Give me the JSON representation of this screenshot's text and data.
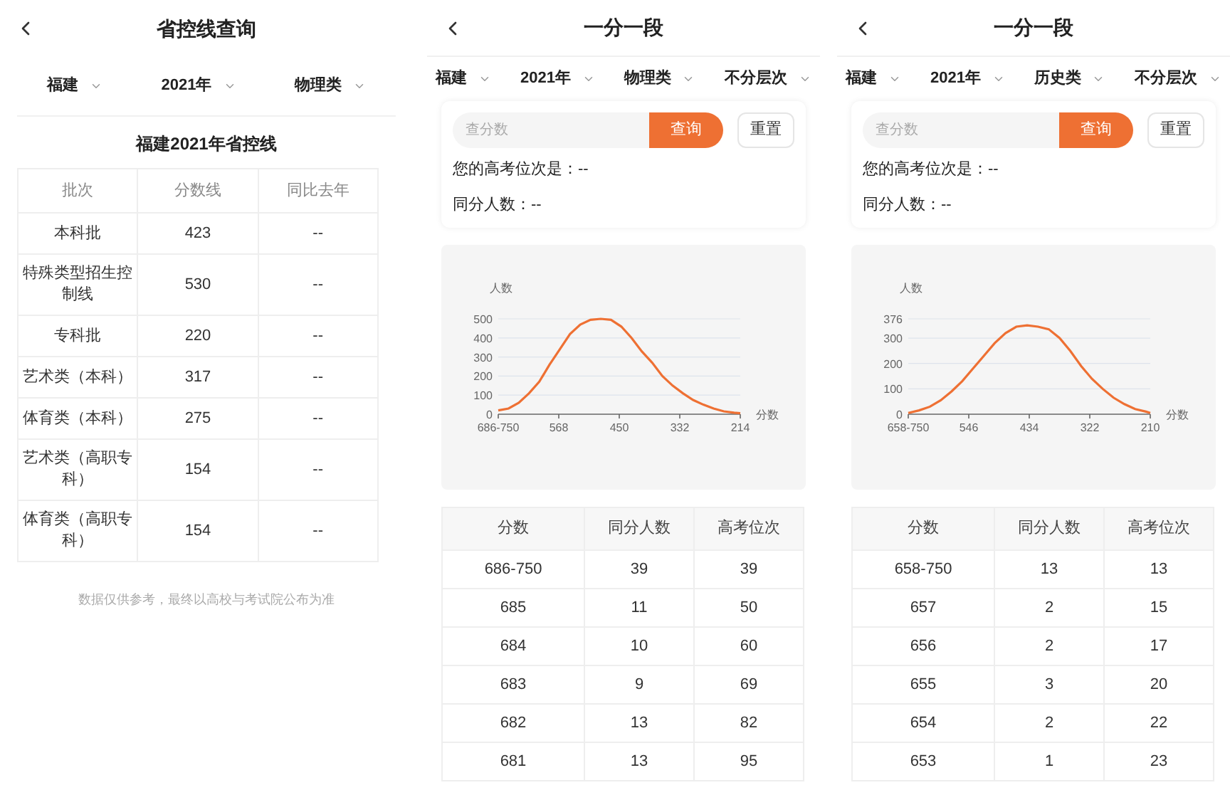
{
  "screens": [
    {
      "kind": "control_lines",
      "title": "省控线查询",
      "filters": [
        "福建",
        "2021年",
        "物理类"
      ],
      "heading": "福建2021年省控线",
      "table": {
        "columns": [
          "批次",
          "分数线",
          "同比去年"
        ],
        "rows": [
          [
            "本科批",
            "423",
            "--"
          ],
          [
            "特殊类型招生控制线",
            "530",
            "--"
          ],
          [
            "专科批",
            "220",
            "--"
          ],
          [
            "艺术类（本科）",
            "317",
            "--"
          ],
          [
            "体育类（本科）",
            "275",
            "--"
          ],
          [
            "艺术类（高职专科）",
            "154",
            "--"
          ],
          [
            "体育类（高职专科）",
            "154",
            "--"
          ]
        ]
      },
      "note": "数据仅供参考，最终以高校与考试院公布为准"
    },
    {
      "kind": "rank",
      "title": "一分一段",
      "filters": [
        "福建",
        "2021年",
        "物理类",
        "不分层次"
      ],
      "search": {
        "placeholder": "查分数",
        "button": "查询",
        "reset": "重置"
      },
      "results": [
        "您的高考位次是：--",
        "同分人数：--"
      ],
      "chart_data": {
        "type": "line",
        "xlabel": "分数",
        "ylabel": "人数",
        "x": [
          686,
          666,
          646,
          626,
          606,
          586,
          566,
          546,
          526,
          506,
          486,
          466,
          446,
          426,
          406,
          386,
          366,
          346,
          326,
          306,
          286,
          266,
          246,
          226,
          214
        ],
        "xlim": [
          686,
          214
        ],
        "ylim": [
          0,
          500
        ],
        "grid": true,
        "xticks": [
          {
            "value": 686,
            "label": "686-750"
          },
          568,
          450,
          332,
          214
        ],
        "yticks": [
          0,
          100,
          200,
          300,
          400,
          500
        ],
        "series": [
          {
            "color": "#ee7033",
            "values": [
              20,
              30,
              60,
              110,
              170,
              260,
              340,
              420,
              470,
              495,
              500,
              495,
              460,
              400,
              330,
              270,
              200,
              150,
              110,
              75,
              50,
              30,
              15,
              8,
              5
            ]
          }
        ]
      },
      "table": {
        "columns": [
          "分数",
          "同分人数",
          "高考位次"
        ],
        "rows": [
          [
            "686-750",
            "39",
            "39"
          ],
          [
            "685",
            "11",
            "50"
          ],
          [
            "684",
            "10",
            "60"
          ],
          [
            "683",
            "9",
            "69"
          ],
          [
            "682",
            "13",
            "82"
          ],
          [
            "681",
            "13",
            "95"
          ]
        ]
      }
    },
    {
      "kind": "rank",
      "title": "一分一段",
      "filters": [
        "福建",
        "2021年",
        "历史类",
        "不分层次"
      ],
      "search": {
        "placeholder": "查分数",
        "button": "查询",
        "reset": "重置"
      },
      "results": [
        "您的高考位次是：--",
        "同分人数：--"
      ],
      "chart_data": {
        "type": "line",
        "xlabel": "分数",
        "ylabel": "人数",
        "x": [
          658,
          638,
          618,
          598,
          578,
          558,
          538,
          518,
          498,
          478,
          458,
          438,
          418,
          398,
          378,
          358,
          338,
          318,
          298,
          278,
          258,
          238,
          218,
          210
        ],
        "xlim": [
          658,
          210
        ],
        "ylim": [
          0,
          376
        ],
        "grid": true,
        "xticks": [
          {
            "value": 658,
            "label": "658-750"
          },
          546,
          434,
          322,
          210
        ],
        "yticks": [
          0,
          100,
          200,
          300,
          376
        ],
        "series": [
          {
            "color": "#ee7033",
            "values": [
              5,
              15,
              30,
              55,
              90,
              130,
              180,
              230,
              280,
              320,
              345,
              350,
              345,
              335,
              300,
              250,
              190,
              140,
              100,
              65,
              40,
              20,
              10,
              5
            ]
          }
        ]
      },
      "table": {
        "columns": [
          "分数",
          "同分人数",
          "高考位次"
        ],
        "rows": [
          [
            "658-750",
            "13",
            "13"
          ],
          [
            "657",
            "2",
            "15"
          ],
          [
            "656",
            "2",
            "17"
          ],
          [
            "655",
            "3",
            "20"
          ],
          [
            "654",
            "2",
            "22"
          ],
          [
            "653",
            "1",
            "23"
          ]
        ]
      }
    }
  ]
}
